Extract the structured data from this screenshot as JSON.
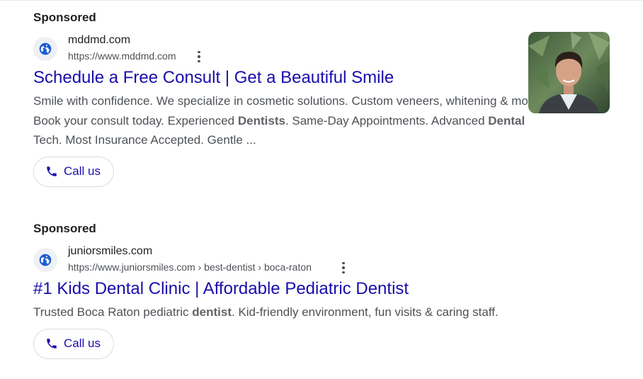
{
  "ads": [
    {
      "sponsored_label": "Sponsored",
      "site_name": "mddmd.com",
      "site_url": "https://www.mddmd.com",
      "icon": "globe-icon",
      "title": "Schedule a Free Consult | Get a Beautiful Smile",
      "desc": {
        "p1": "Smile with confidence. We specialize in cosmetic solutions. Custom veneers, whitening & more. Book your consult today. Experienced ",
        "b1": "Dentists",
        "p2": ". Same-Day Appointments. Advanced ",
        "b2": "Dental",
        "p3": " Tech. Most Insurance Accepted. Gentle ..."
      },
      "call_label": "Call us",
      "has_thumbnail": true
    },
    {
      "sponsored_label": "Sponsored",
      "site_name": "juniorsmiles.com",
      "site_url": "https://www.juniorsmiles.com › best-dentist › boca-raton",
      "icon": "globe-icon",
      "title": "#1 Kids Dental Clinic | Affordable Pediatric Dentist",
      "desc": {
        "p1": "Trusted Boca Raton pediatric ",
        "b1": "dentist",
        "p2": ". Kid-friendly environment, fun visits & caring staff."
      },
      "call_label": "Call us",
      "has_thumbnail": false
    }
  ],
  "colors": {
    "link": "#1a0dab",
    "text": "#202124",
    "muted": "#4d5156",
    "globe": "#1a5fd1",
    "favicon_bg": "#eef0f6"
  }
}
